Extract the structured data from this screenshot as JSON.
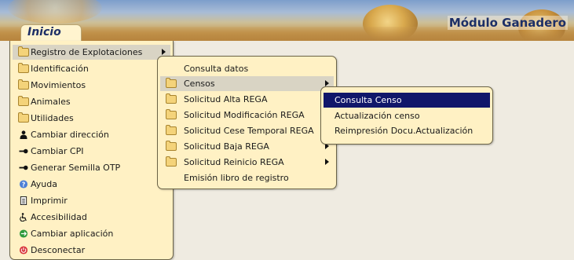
{
  "header": {
    "module_title": "Módulo Ganadero",
    "start_tab": "Inicio"
  },
  "main_menu": [
    {
      "label": "Registro de Explotaciones",
      "icon": "folder-icon",
      "submenu": true,
      "highlighted": true
    },
    {
      "label": "Identificación",
      "icon": "folder-icon"
    },
    {
      "label": "Movimientos",
      "icon": "folder-icon"
    },
    {
      "label": "Animales",
      "icon": "folder-icon"
    },
    {
      "label": "Utilidades",
      "icon": "folder-icon"
    },
    {
      "label": "Cambiar dirección",
      "icon": "user-icon"
    },
    {
      "label": "Cambiar CPI",
      "icon": "key-icon"
    },
    {
      "label": "Generar Semilla OTP",
      "icon": "key-icon"
    },
    {
      "label": "Ayuda",
      "icon": "help-icon"
    },
    {
      "label": "Imprimir",
      "icon": "printer-icon"
    },
    {
      "label": "Accesibilidad",
      "icon": "accessibility-icon"
    },
    {
      "label": "Cambiar aplicación",
      "icon": "switch-app-icon"
    },
    {
      "label": "Desconectar",
      "icon": "power-icon"
    }
  ],
  "submenu_registro": [
    {
      "label": "Consulta datos"
    },
    {
      "label": "Censos",
      "icon": "folder-icon",
      "submenu": true,
      "highlighted": true
    },
    {
      "label": "Solicitud Alta REGA",
      "icon": "folder-icon"
    },
    {
      "label": "Solicitud Modificación REGA",
      "icon": "folder-icon"
    },
    {
      "label": "Solicitud Cese Temporal REGA",
      "icon": "folder-icon"
    },
    {
      "label": "Solicitud Baja REGA",
      "icon": "folder-icon",
      "submenu": true
    },
    {
      "label": "Solicitud Reinicio REGA",
      "icon": "folder-icon",
      "submenu": true
    },
    {
      "label": "Emisión libro de registro"
    }
  ],
  "submenu_censos": [
    {
      "label": "Consulta Censo",
      "selected": true
    },
    {
      "label": "Actualización censo"
    },
    {
      "label": "Reimpresión Docu.Actualización"
    }
  ],
  "colors": {
    "menu_bg": "#fff1c4",
    "selected_bg": "#10176a",
    "highlight_bg": "#d9d4c4",
    "title_color": "#1d2f66"
  }
}
